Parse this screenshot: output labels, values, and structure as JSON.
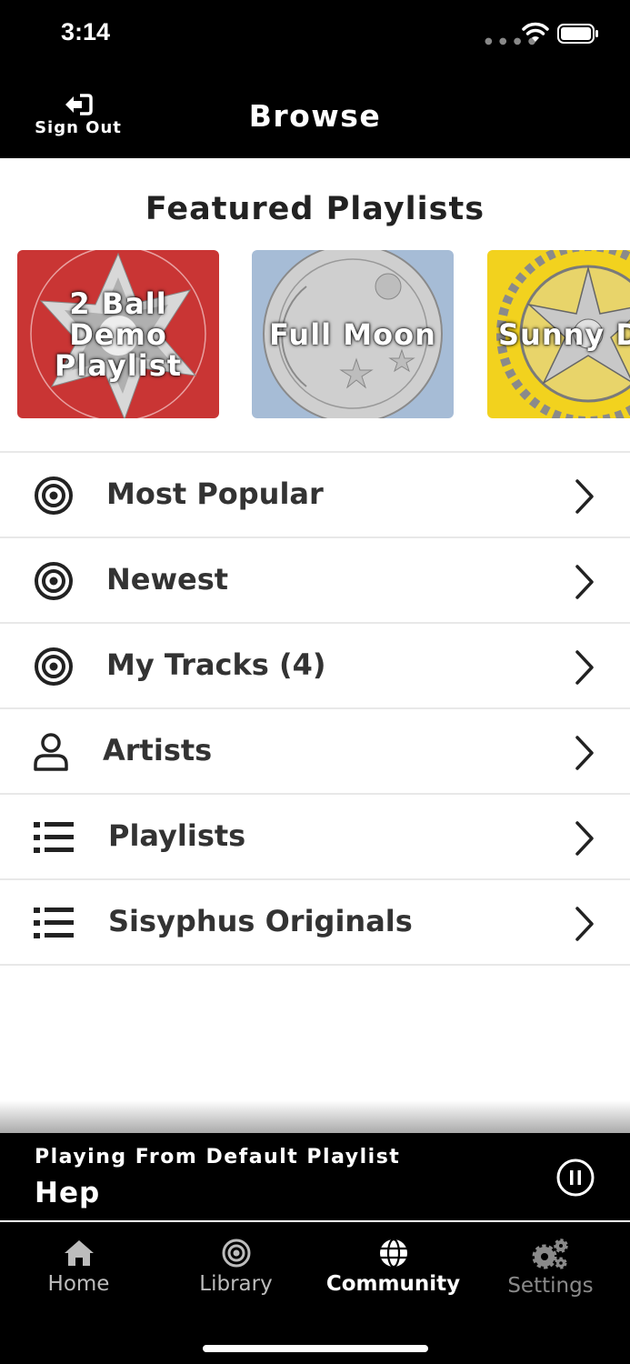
{
  "status_bar": {
    "time": "3:14"
  },
  "nav": {
    "signout_label": "Sign Out",
    "title": "Browse"
  },
  "featured": {
    "title": "Featured Playlists",
    "playlists": [
      {
        "label": "2 Ball\nDemo\nPlaylist",
        "bg": "#c93534"
      },
      {
        "label": "Full Moon",
        "bg": "#a6bcd6"
      },
      {
        "label": "Sunny D",
        "bg": "#f2d21e"
      }
    ]
  },
  "menu": [
    {
      "label": "Most Popular",
      "icon": "target-icon"
    },
    {
      "label": "Newest",
      "icon": "target-icon"
    },
    {
      "label": "My Tracks (4)",
      "icon": "target-icon"
    },
    {
      "label": "Artists",
      "icon": "person-icon"
    },
    {
      "label": "Playlists",
      "icon": "list-icon"
    },
    {
      "label": "Sisyphus Originals",
      "icon": "list-icon"
    }
  ],
  "now_playing": {
    "context": "Playing From Default Playlist",
    "track": "Hep"
  },
  "tabs": [
    {
      "label": "Home",
      "icon": "home-icon",
      "color": "#bcbcbc"
    },
    {
      "label": "Library",
      "icon": "target-icon",
      "color": "#bcbcbc"
    },
    {
      "label": "Community",
      "icon": "globe-icon",
      "color": "#ffffff",
      "active": true
    },
    {
      "label": "Settings",
      "icon": "gear-icon",
      "color": "#8a8a8a"
    }
  ],
  "colors": {
    "background": "#000000",
    "content": "#ffffff",
    "text": "#333333",
    "divider": "#e8e8e8"
  }
}
